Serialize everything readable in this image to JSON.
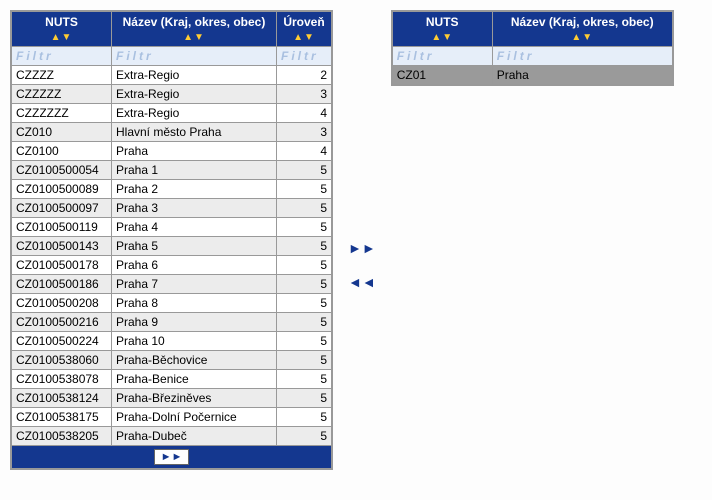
{
  "headers": {
    "nuts": "NUTS",
    "name": "Název (Kraj, okres, obec)",
    "level": "Úroveň"
  },
  "sortGlyphs": {
    "up": "▲",
    "down": "▼"
  },
  "filterLabel": "Filtr",
  "pager": {
    "next": "►►"
  },
  "transfer": {
    "add": "►►",
    "remove": "◄◄"
  },
  "leftRows": [
    {
      "nuts": "CZZZZ",
      "name": "Extra-Regio",
      "level": 2
    },
    {
      "nuts": "CZZZZZ",
      "name": "Extra-Regio",
      "level": 3
    },
    {
      "nuts": "CZZZZZZ",
      "name": "Extra-Regio",
      "level": 4
    },
    {
      "nuts": "CZ010",
      "name": "Hlavní město Praha",
      "level": 3
    },
    {
      "nuts": "CZ0100",
      "name": "Praha",
      "level": 4
    },
    {
      "nuts": "CZ0100500054",
      "name": "Praha 1",
      "level": 5
    },
    {
      "nuts": "CZ0100500089",
      "name": "Praha 2",
      "level": 5
    },
    {
      "nuts": "CZ0100500097",
      "name": "Praha 3",
      "level": 5
    },
    {
      "nuts": "CZ0100500119",
      "name": "Praha 4",
      "level": 5
    },
    {
      "nuts": "CZ0100500143",
      "name": "Praha 5",
      "level": 5
    },
    {
      "nuts": "CZ0100500178",
      "name": "Praha 6",
      "level": 5
    },
    {
      "nuts": "CZ0100500186",
      "name": "Praha 7",
      "level": 5
    },
    {
      "nuts": "CZ0100500208",
      "name": "Praha 8",
      "level": 5
    },
    {
      "nuts": "CZ0100500216",
      "name": "Praha 9",
      "level": 5
    },
    {
      "nuts": "CZ0100500224",
      "name": "Praha 10",
      "level": 5
    },
    {
      "nuts": "CZ0100538060",
      "name": "Praha-Běchovice",
      "level": 5
    },
    {
      "nuts": "CZ0100538078",
      "name": "Praha-Benice",
      "level": 5
    },
    {
      "nuts": "CZ0100538124",
      "name": "Praha-Březiněves",
      "level": 5
    },
    {
      "nuts": "CZ0100538175",
      "name": "Praha-Dolní Počernice",
      "level": 5
    },
    {
      "nuts": "CZ0100538205",
      "name": "Praha-Dubeč",
      "level": 5
    }
  ],
  "rightRows": [
    {
      "nuts": "CZ01",
      "name": "Praha",
      "selected": true
    }
  ]
}
